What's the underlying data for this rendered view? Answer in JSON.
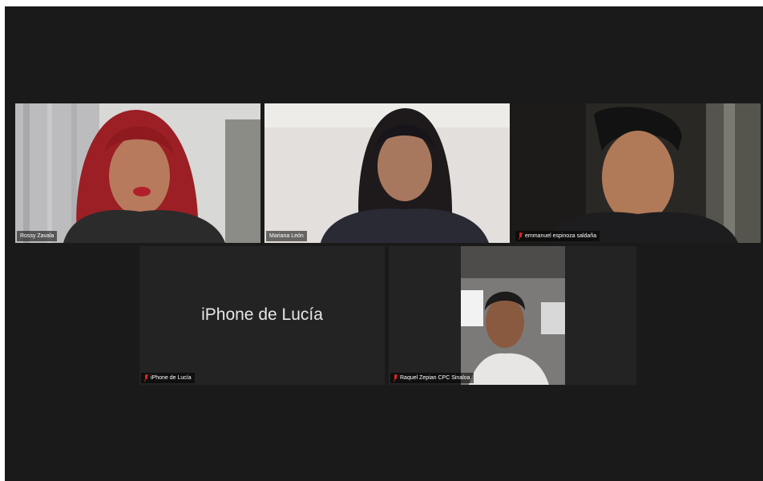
{
  "participants": [
    {
      "name": "Rossy Zavala",
      "muted": false,
      "active_speaker": true,
      "video": "on"
    },
    {
      "name": "Mariana León",
      "muted": false,
      "active_speaker": false,
      "video": "on"
    },
    {
      "name": "emmanuel espinoza saldaña",
      "muted": true,
      "active_speaker": false,
      "video": "on"
    },
    {
      "name": "iPhone de Lucía",
      "muted": true,
      "active_speaker": false,
      "video": "off",
      "display_text": "iPhone de Lucía"
    },
    {
      "name": "Raquel Zepian CPC Sinaloa",
      "muted": true,
      "active_speaker": false,
      "video": "on"
    }
  ],
  "colors": {
    "background": "#1a1a1a",
    "tile": "#232323",
    "active_border": "#22b14c",
    "muted_icon": "#e02424"
  }
}
